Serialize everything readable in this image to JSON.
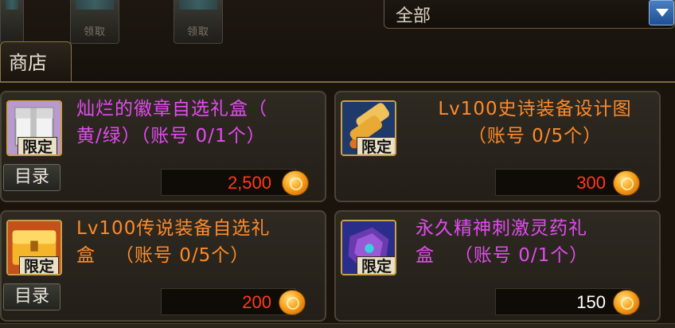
{
  "header": {
    "slot_labels": [
      "",
      "领取",
      "领取",
      ""
    ],
    "filter_value": "全部",
    "shop_tab_label": "商店"
  },
  "items": [
    {
      "name": "灿烂的徽章自选礼盒（黄/绿）（账号 0/1个）",
      "name_line1": "灿烂的徽章自选礼盒（",
      "name_line2": "黄/绿）（账号 0/1个）",
      "price": "2,500",
      "badge": "限定",
      "catalog_label": "目录",
      "name_color": "#e34bf0",
      "price_color": "#ff3a1a",
      "icon": "gift-box-icon"
    },
    {
      "name": "Lv100史诗装备设计图（账号 0/5个）",
      "name_line1": "Lv100史诗装备设计图",
      "name_line2": "（账号 0/5个）",
      "price": "300",
      "badge": "限定",
      "name_color": "#ff8a2a",
      "price_color": "#ff3a1a",
      "icon": "scroll-blueprint-icon"
    },
    {
      "name": "Lv100传说装备自选礼盒（账号 0/5个）",
      "name_line1": "Lv100传说装备自选礼",
      "name_line2": "盒   （账号 0/5个）",
      "price": "200",
      "badge": "限定",
      "catalog_label": "目录",
      "name_color": "#ff8a2a",
      "price_color": "#ff3a1a",
      "icon": "golden-chest-icon"
    },
    {
      "name": "永久精神刺激灵药礼盒（账号 0/1个）",
      "name_line1": "永久精神刺激灵药礼",
      "name_line2": "盒   （账号 0/1个）",
      "price": "150",
      "badge": "限定",
      "name_color": "#e34bf0",
      "price_color": "#ffffff",
      "icon": "potion-box-icon"
    }
  ]
}
